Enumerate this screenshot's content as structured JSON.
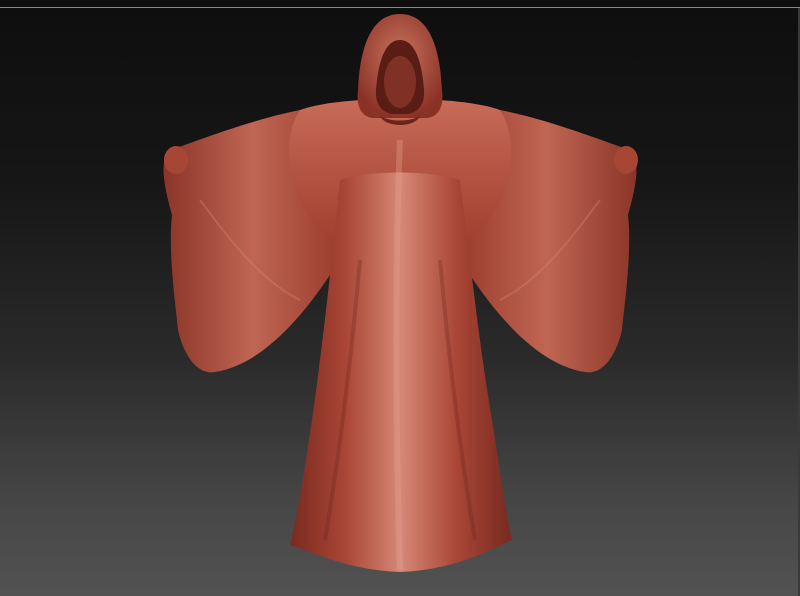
{
  "viewport": {
    "background_top": "#0e0e0e",
    "background_bottom": "#525252"
  },
  "model": {
    "subject": "hooded-robe-sculpt",
    "material_color": "#b24a3a"
  }
}
